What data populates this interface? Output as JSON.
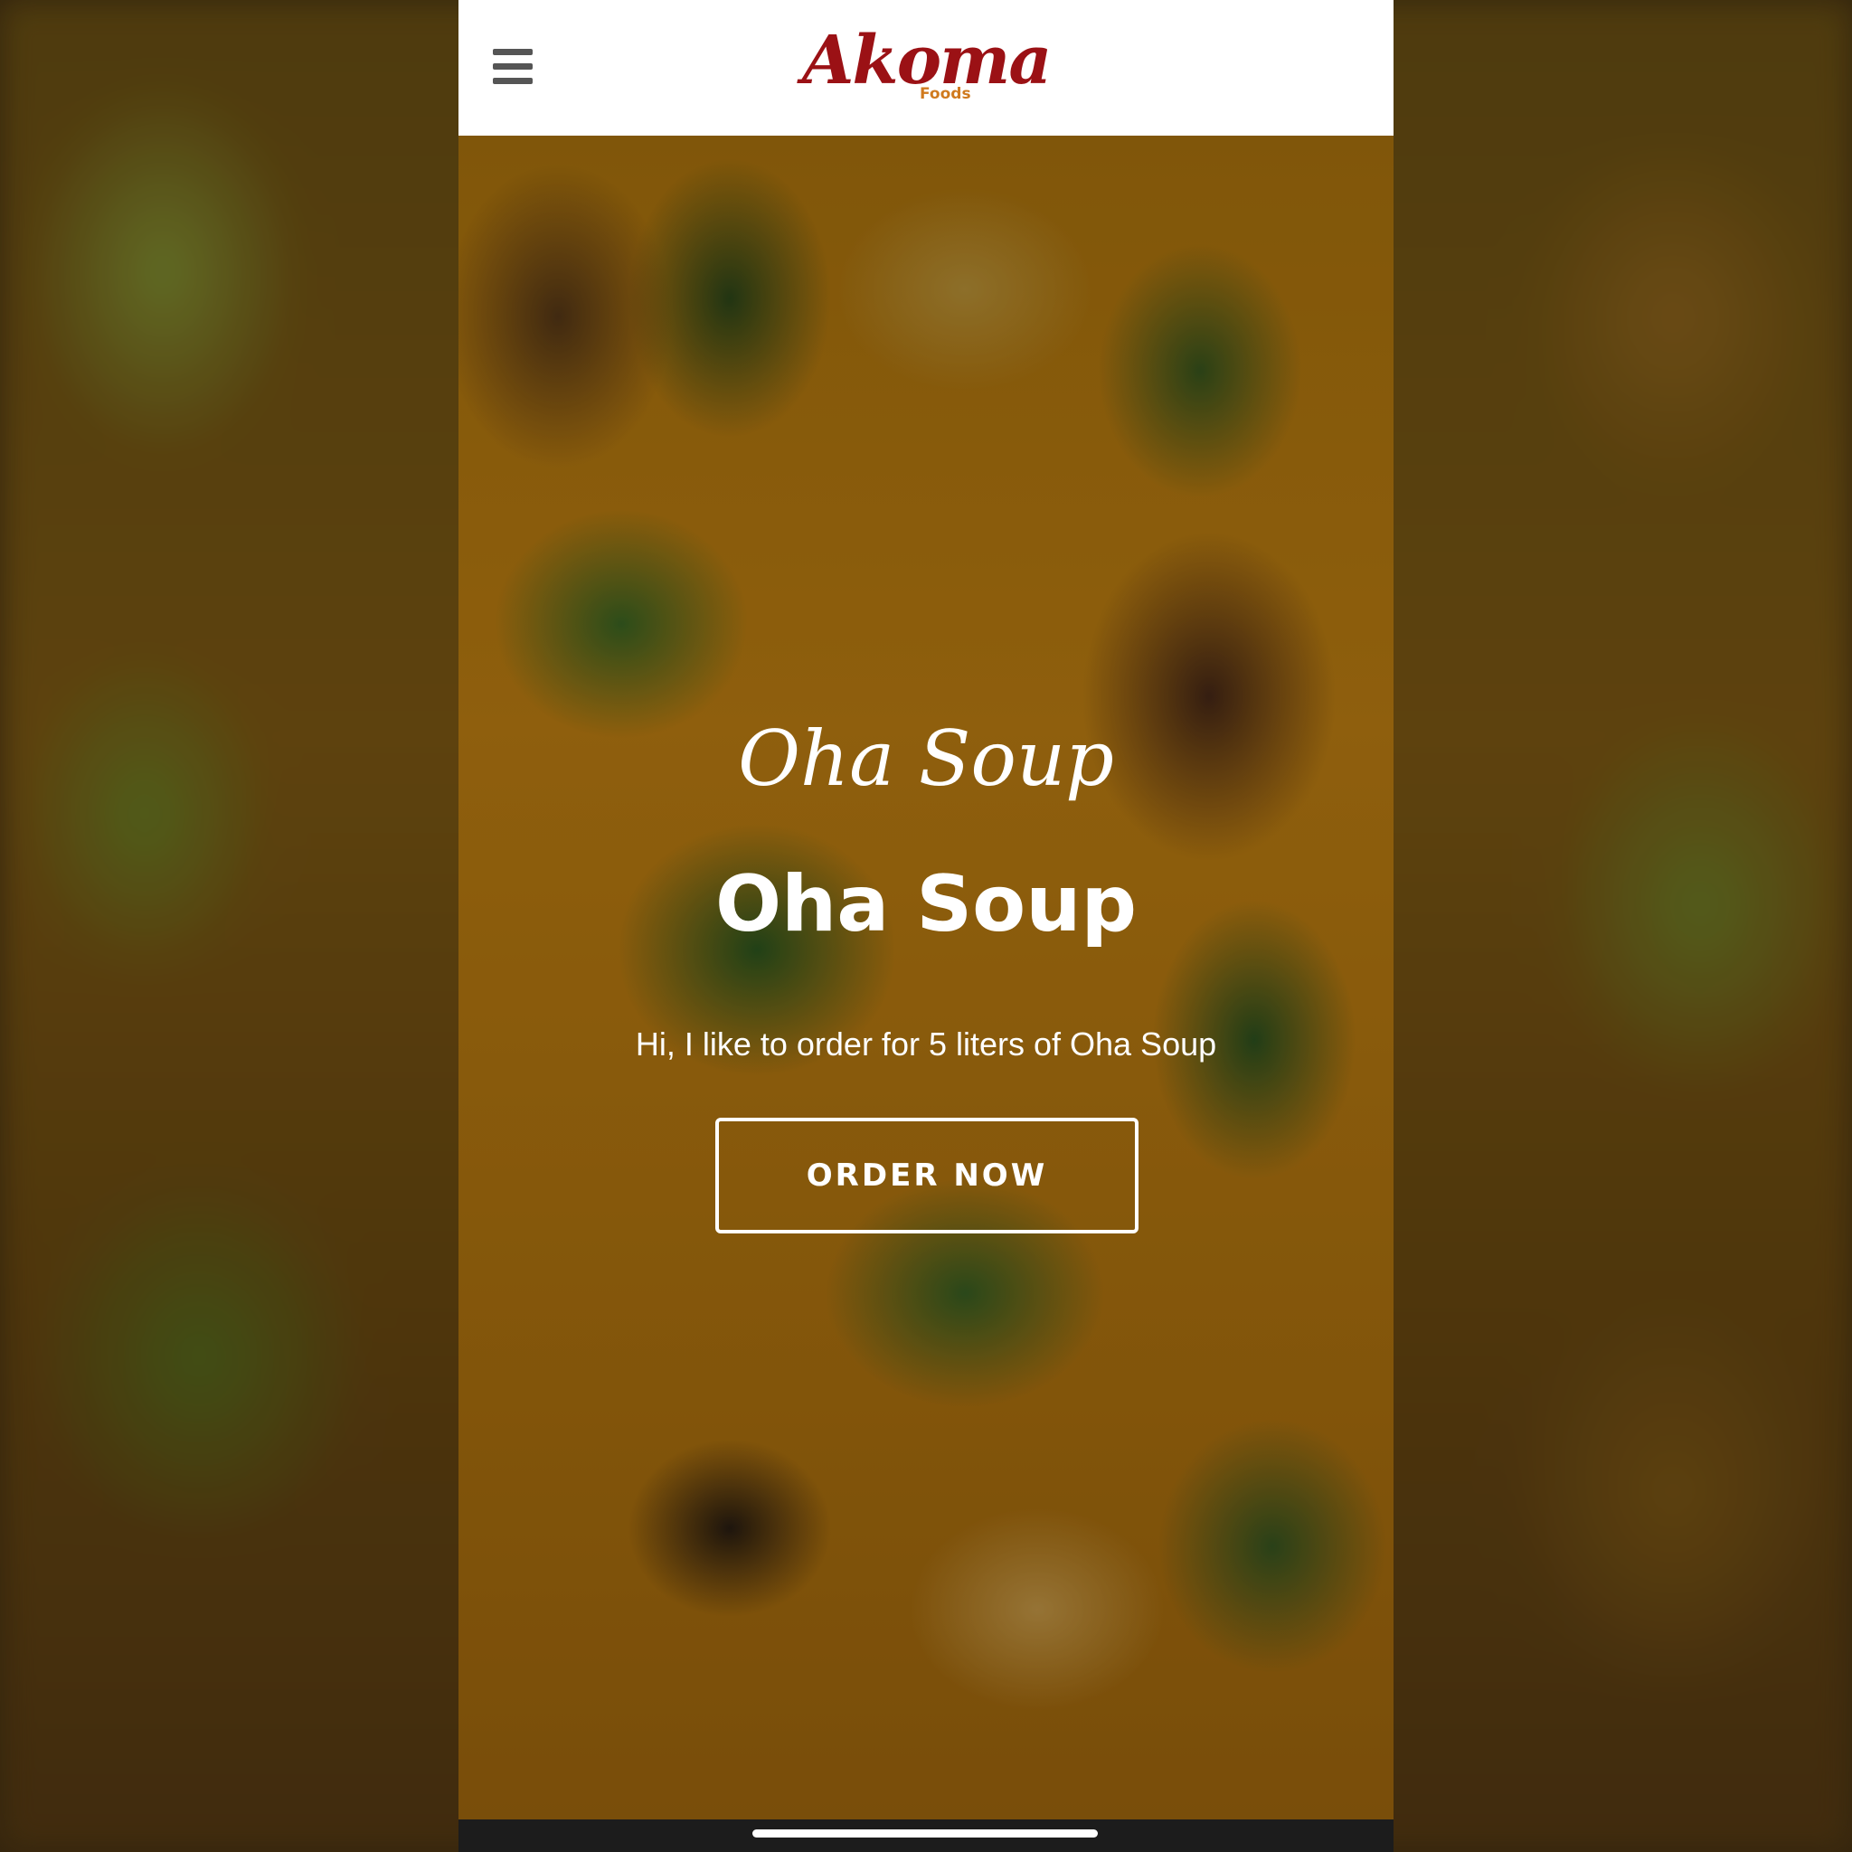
{
  "header": {
    "logo_text": "Akoma",
    "logo_subtext": "Foods",
    "menu_icon": "hamburger-menu-icon"
  },
  "hero": {
    "script_title": "Oha Soup",
    "title": "Oha Soup",
    "description": "Hi, I like to order for 5 liters of Oha Soup",
    "button_label": "ORDER NOW"
  },
  "colors": {
    "brand_red": "#9b1115",
    "brand_orange": "#d07a1e",
    "header_bg": "#ffffff",
    "text_light": "#ffffff"
  }
}
